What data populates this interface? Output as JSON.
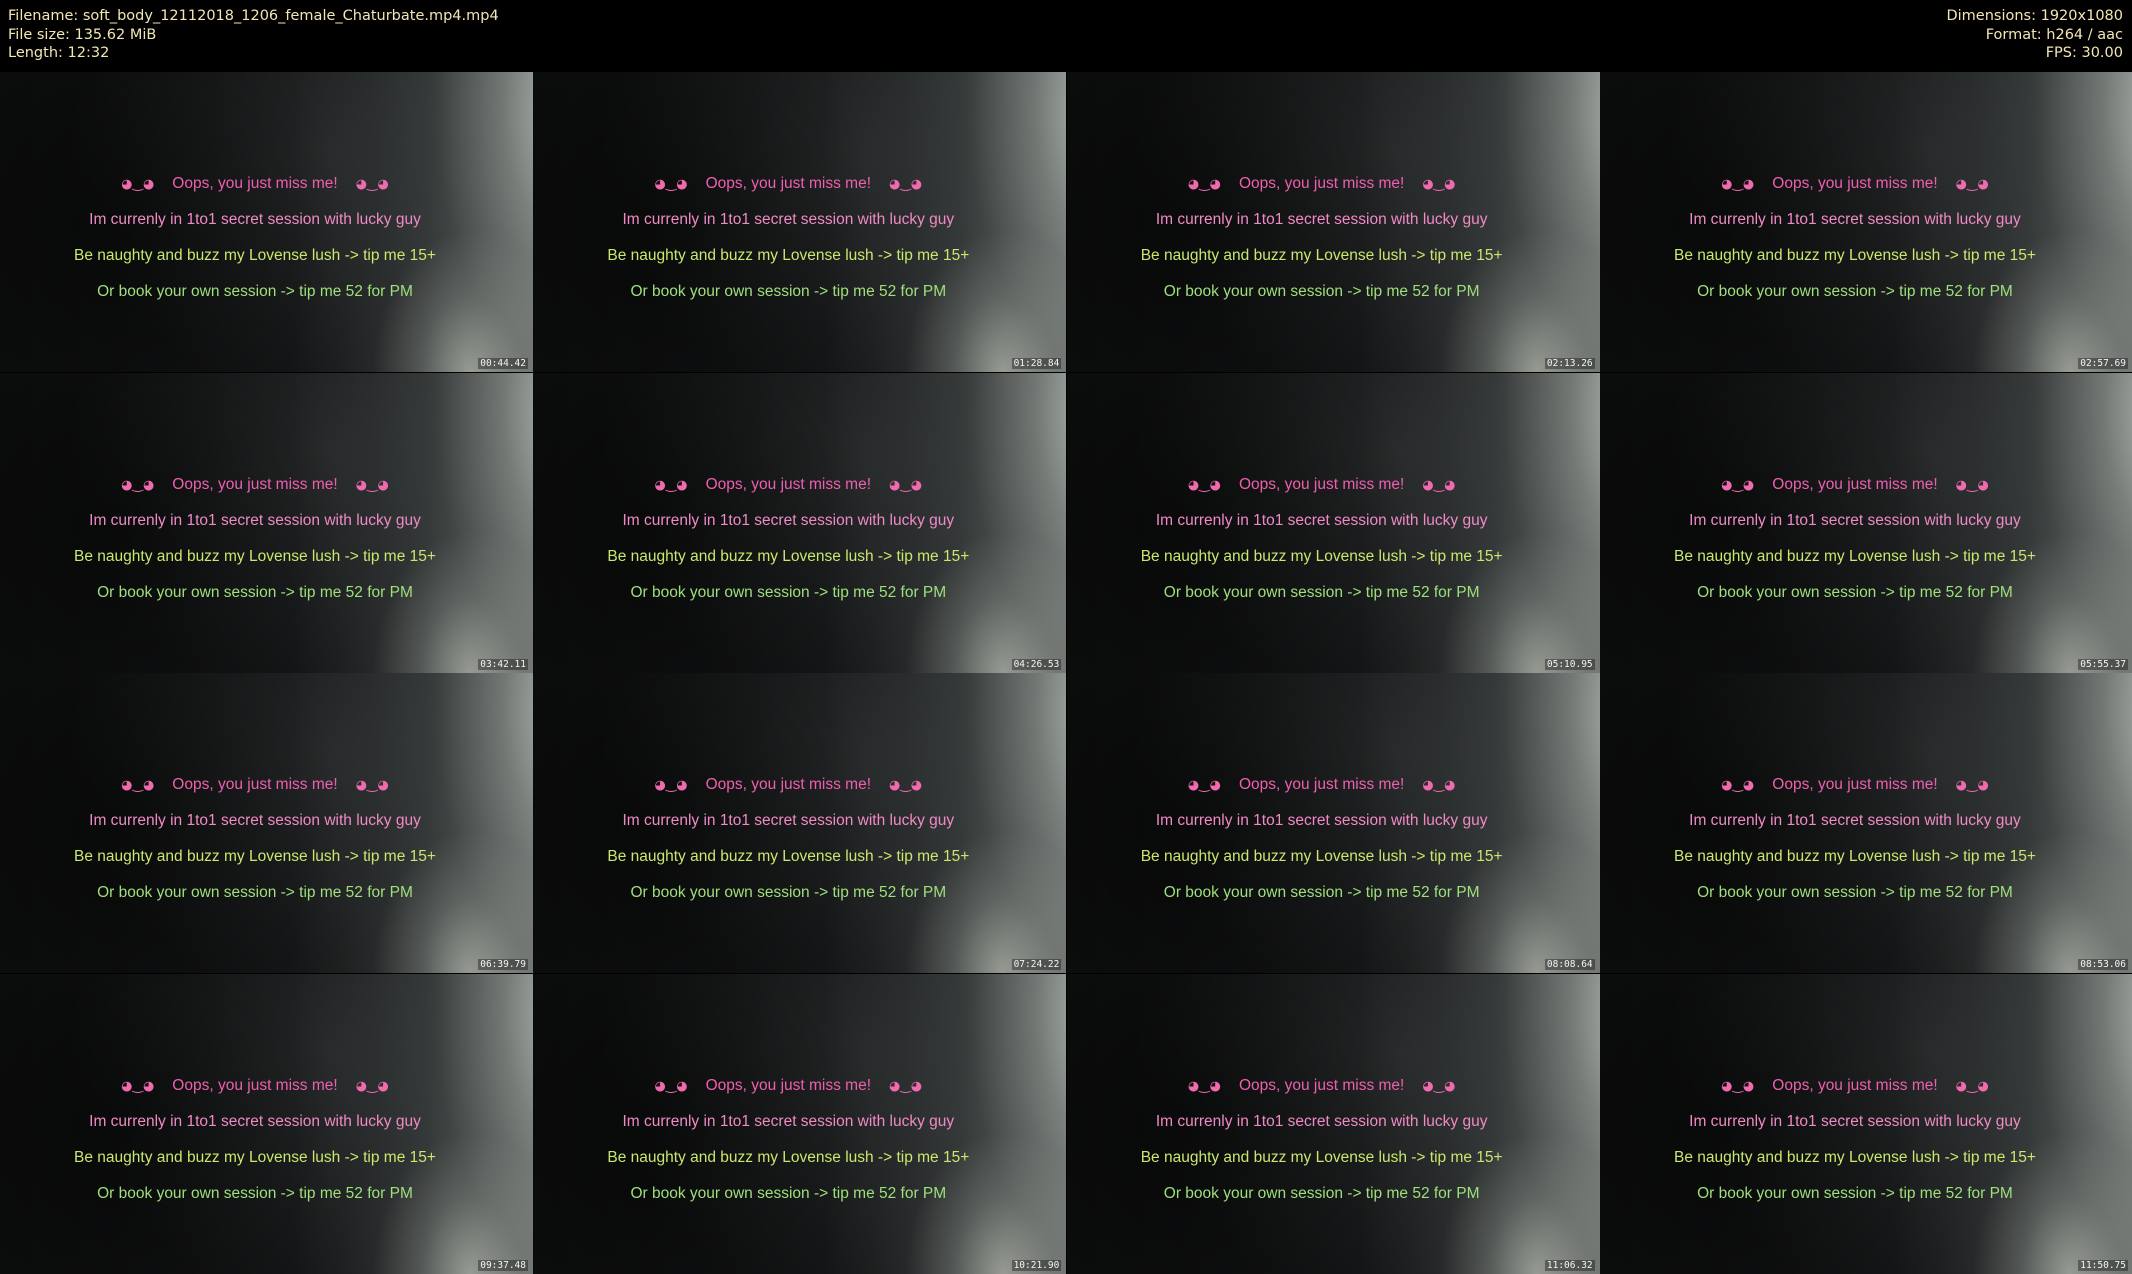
{
  "header": {
    "filename": "Filename: soft_body_12112018_1206_female_Chaturbate.mp4.mp4",
    "filesize": "File size: 135.62 MiB",
    "length": "Length: 12:32",
    "dimensions": "Dimensions: 1920x1080",
    "format": "Format: h264 / aac",
    "fps": "FPS: 30.00"
  },
  "overlay": {
    "face_left": "◕‿◕",
    "face_right": "◕‿◕",
    "line1": "Oops, you just miss me!",
    "line2": "Im currenly in 1to1 secret session with lucky guy",
    "line3": "Be naughty and buzz my Lovense lush -> tip me 15+",
    "line4": "Or book your own session -> tip me 52 for PM"
  },
  "thumbnails": [
    {
      "timestamp": "00:44.42"
    },
    {
      "timestamp": "01:28.84"
    },
    {
      "timestamp": "02:13.26"
    },
    {
      "timestamp": "02:57.69"
    },
    {
      "timestamp": "03:42.11"
    },
    {
      "timestamp": "04:26.53"
    },
    {
      "timestamp": "05:10.95"
    },
    {
      "timestamp": "05:55.37"
    },
    {
      "timestamp": "06:39.79"
    },
    {
      "timestamp": "07:24.22"
    },
    {
      "timestamp": "08:08.64"
    },
    {
      "timestamp": "08:53.06"
    },
    {
      "timestamp": "09:37.48"
    },
    {
      "timestamp": "10:21.90"
    },
    {
      "timestamp": "11:06.32"
    },
    {
      "timestamp": "11:50.75"
    }
  ]
}
